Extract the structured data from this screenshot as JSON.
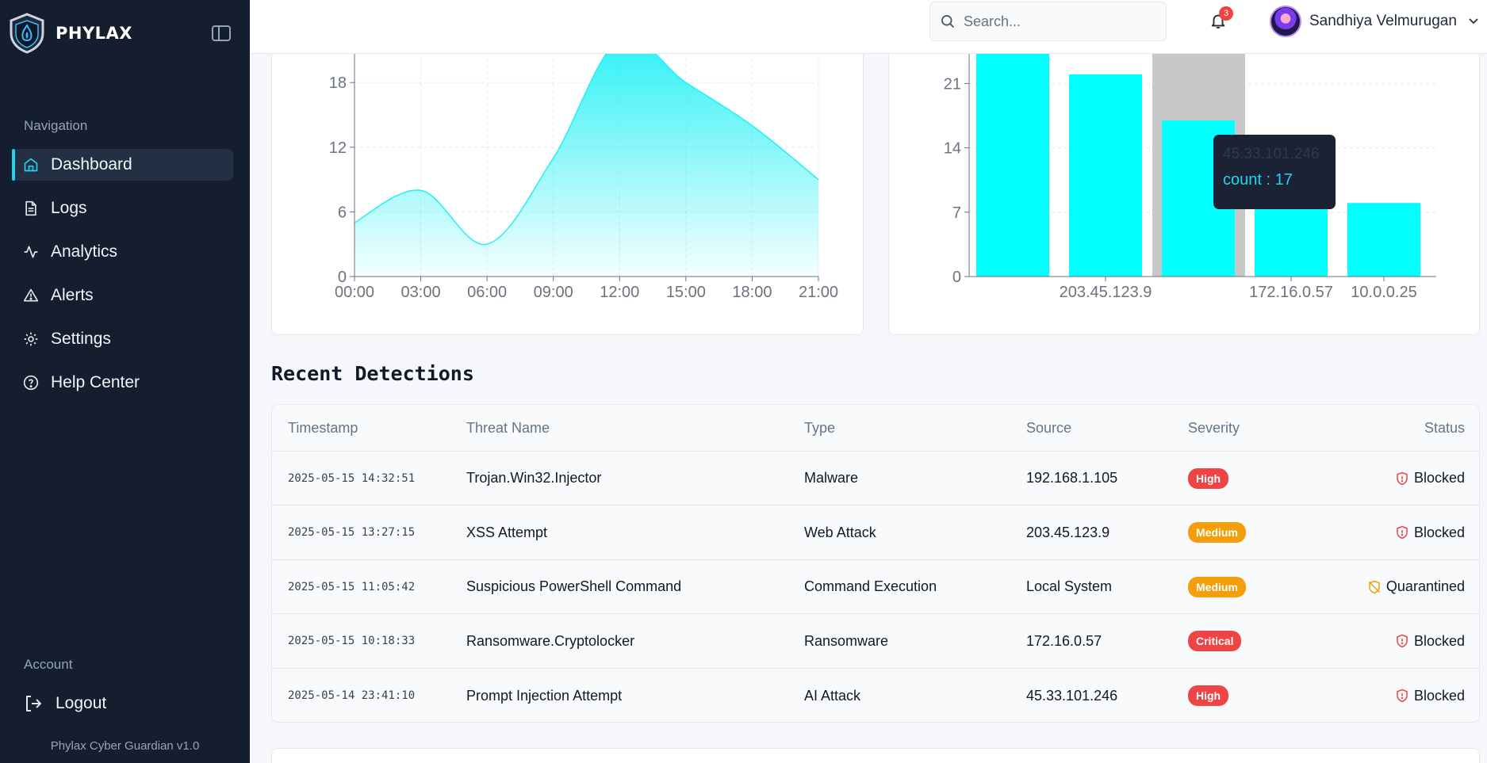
{
  "brand": {
    "name": "PHYLAX"
  },
  "sidebar": {
    "nav_heading": "Navigation",
    "items": [
      {
        "label": "Dashboard",
        "icon": "home-icon",
        "active": true
      },
      {
        "label": "Logs",
        "icon": "file-text-icon"
      },
      {
        "label": "Analytics",
        "icon": "activity-icon"
      },
      {
        "label": "Alerts",
        "icon": "alert-triangle-icon"
      },
      {
        "label": "Settings",
        "icon": "gear-icon"
      },
      {
        "label": "Help Center",
        "icon": "help-circle-icon"
      }
    ],
    "account_heading": "Account",
    "logout_label": "Logout",
    "version": "Phylax Cyber Guardian v1.0"
  },
  "header": {
    "search_placeholder": "Search...",
    "notification_count": "3",
    "user_name": "Sandhiya Velmurugan"
  },
  "chart_data": [
    {
      "type": "area",
      "x": [
        "00:00",
        "03:00",
        "06:00",
        "09:00",
        "12:00",
        "15:00",
        "18:00",
        "21:00"
      ],
      "values": [
        5,
        8,
        3,
        11,
        22,
        18,
        14,
        9
      ],
      "yticks": [
        0,
        6,
        12,
        18
      ],
      "ylim": [
        0,
        24
      ],
      "grid": true,
      "color": "#22f0f5"
    },
    {
      "type": "bar",
      "categories": [
        "",
        "203.45.123.9",
        "45.33.101.246",
        "172.16.0.57",
        "10.0.0.25"
      ],
      "x_tick_labels": [
        "203.45.123.9",
        "172.16.0.57",
        "10.0.0.25"
      ],
      "series": [
        {
          "values": [
            26,
            22,
            17,
            8,
            8
          ]
        }
      ],
      "yticks": [
        0,
        7,
        14,
        21
      ],
      "ylim": [
        0,
        24
      ],
      "grid": true,
      "color": "#00ffff",
      "highlight_index": 2,
      "tooltip": {
        "label": "45.33.101.246",
        "value_text": "count : 17"
      }
    }
  ],
  "detections": {
    "title": "Recent Detections",
    "columns": [
      "Timestamp",
      "Threat Name",
      "Type",
      "Source",
      "Severity",
      "Status"
    ],
    "rows": [
      {
        "timestamp": "2025-05-15 14:32:51",
        "name": "Trojan.Win32.Injector",
        "type": "Malware",
        "source": "192.168.1.105",
        "severity": "High",
        "status": "Blocked"
      },
      {
        "timestamp": "2025-05-15 13:27:15",
        "name": "XSS Attempt",
        "type": "Web Attack",
        "source": "203.45.123.9",
        "severity": "Medium",
        "status": "Blocked"
      },
      {
        "timestamp": "2025-05-15 11:05:42",
        "name": "Suspicious PowerShell Command",
        "type": "Command Execution",
        "source": "Local System",
        "severity": "Medium",
        "status": "Quarantined"
      },
      {
        "timestamp": "2025-05-15 10:18:33",
        "name": "Ransomware.Cryptolocker",
        "type": "Ransomware",
        "source": "172.16.0.57",
        "severity": "Critical",
        "status": "Blocked"
      },
      {
        "timestamp": "2025-05-14 23:41:10",
        "name": "Prompt Injection Attempt",
        "type": "AI Attack",
        "source": "45.33.101.246",
        "severity": "High",
        "status": "Blocked"
      }
    ]
  },
  "colors": {
    "accent": "#22d3ee",
    "sidebar_bg": "#141e2e",
    "severity_high": "#ef4444",
    "severity_medium": "#f59e0b",
    "severity_critical": "#ef4444",
    "status_blocked": "#ef4444",
    "status_quarantined": "#f59e0b"
  }
}
